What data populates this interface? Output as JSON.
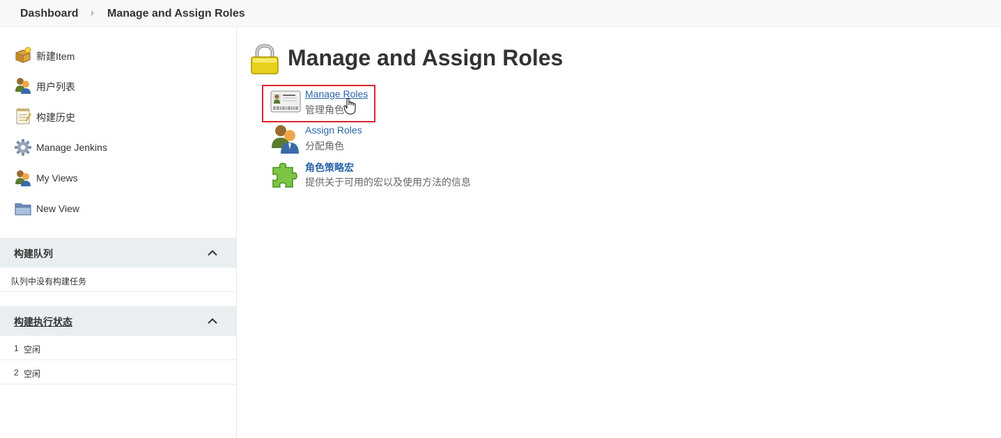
{
  "breadcrumb": {
    "items": [
      "Dashboard",
      "Manage and Assign Roles"
    ]
  },
  "sidebar": {
    "tasks": [
      {
        "label": "新建Item",
        "icon": "new-package-icon"
      },
      {
        "label": "用户列表",
        "icon": "users-icon"
      },
      {
        "label": "构建历史",
        "icon": "notepad-icon"
      },
      {
        "label": "Manage Jenkins",
        "icon": "gear-icon"
      },
      {
        "label": "My Views",
        "icon": "users-icon"
      },
      {
        "label": "New View",
        "icon": "folder-icon"
      }
    ],
    "build_queue": {
      "title": "构建队列",
      "empty_text": "队列中没有构建任务"
    },
    "executors": {
      "title": "构建执行状态",
      "rows": [
        {
          "number": "1",
          "status": "空闲"
        },
        {
          "number": "2",
          "status": "空闲"
        }
      ]
    }
  },
  "main": {
    "title": "Manage and Assign Roles",
    "title_icon": "padlock-icon",
    "entries": [
      {
        "label": "Manage Roles",
        "description": "管理角色",
        "icon": "id-card-icon"
      },
      {
        "label": "Assign Roles",
        "description": "分配角色",
        "icon": "users-icon"
      },
      {
        "label": "角色策略宏",
        "description": "提供关于可用的宏以及使用方法的信息",
        "icon": "puzzle-piece-icon"
      }
    ]
  },
  "colors": {
    "link": "#2a64a6",
    "highlight_border": "#d9252d",
    "panel_header_bg": "#e9eef1",
    "topbar_bg": "#f8f8f8"
  }
}
